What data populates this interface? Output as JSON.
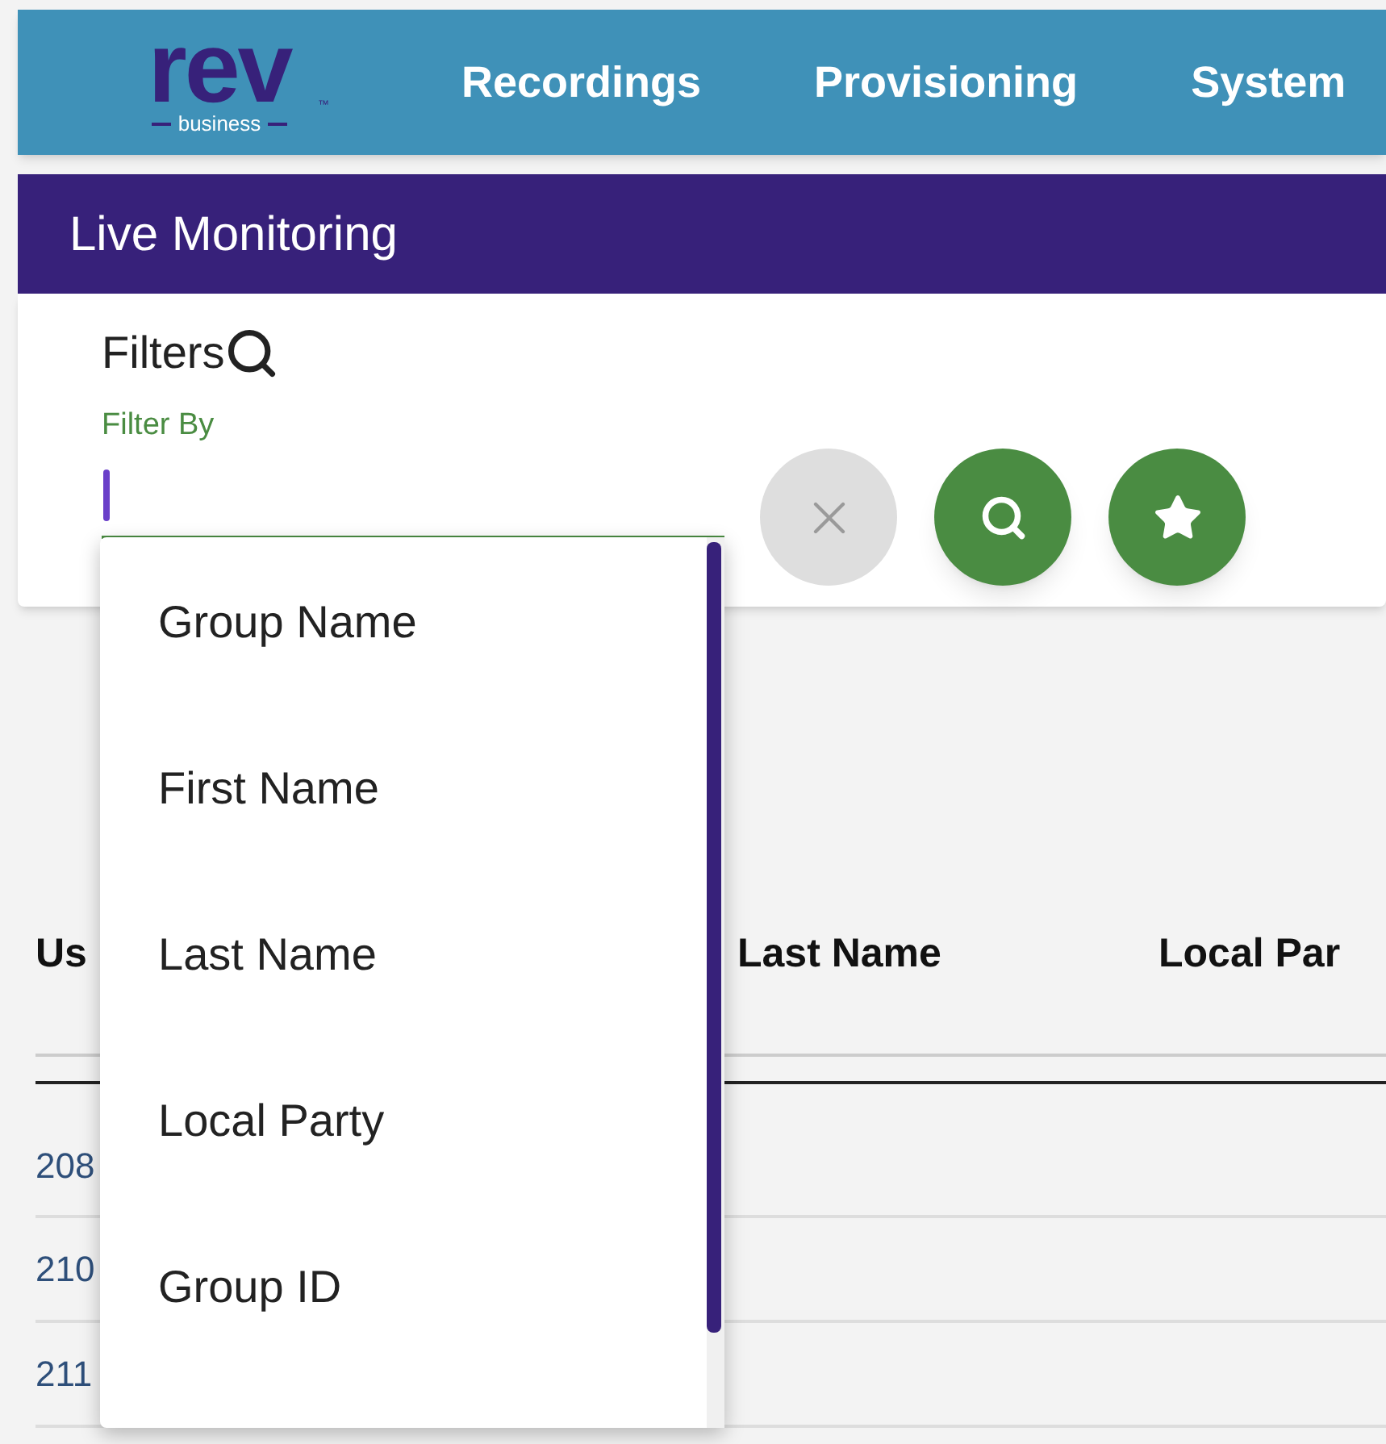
{
  "logo": {
    "word": "rev",
    "tagline": "business",
    "trademark": "™"
  },
  "nav": [
    {
      "label": "Recordings"
    },
    {
      "label": "Provisioning"
    },
    {
      "label": "System"
    }
  ],
  "page_title": "Live Monitoring",
  "filters": {
    "title": "Filters",
    "field_label": "Filter By",
    "focused": true,
    "expanded": true
  },
  "actions": [
    {
      "kind": "clear",
      "disabled": true
    },
    {
      "kind": "search",
      "disabled": false
    },
    {
      "kind": "favorite",
      "disabled": false
    }
  ],
  "dropdown": {
    "options": [
      {
        "label": "Group Name"
      },
      {
        "label": "First Name"
      },
      {
        "label": "Last Name"
      },
      {
        "label": "Local Party"
      },
      {
        "label": "Group ID"
      }
    ]
  },
  "table": {
    "columns": [
      "Us",
      "Last Name",
      "Local Par"
    ],
    "rows": [
      {
        "user": "208"
      },
      {
        "user": "210"
      },
      {
        "user": "211"
      }
    ]
  }
}
